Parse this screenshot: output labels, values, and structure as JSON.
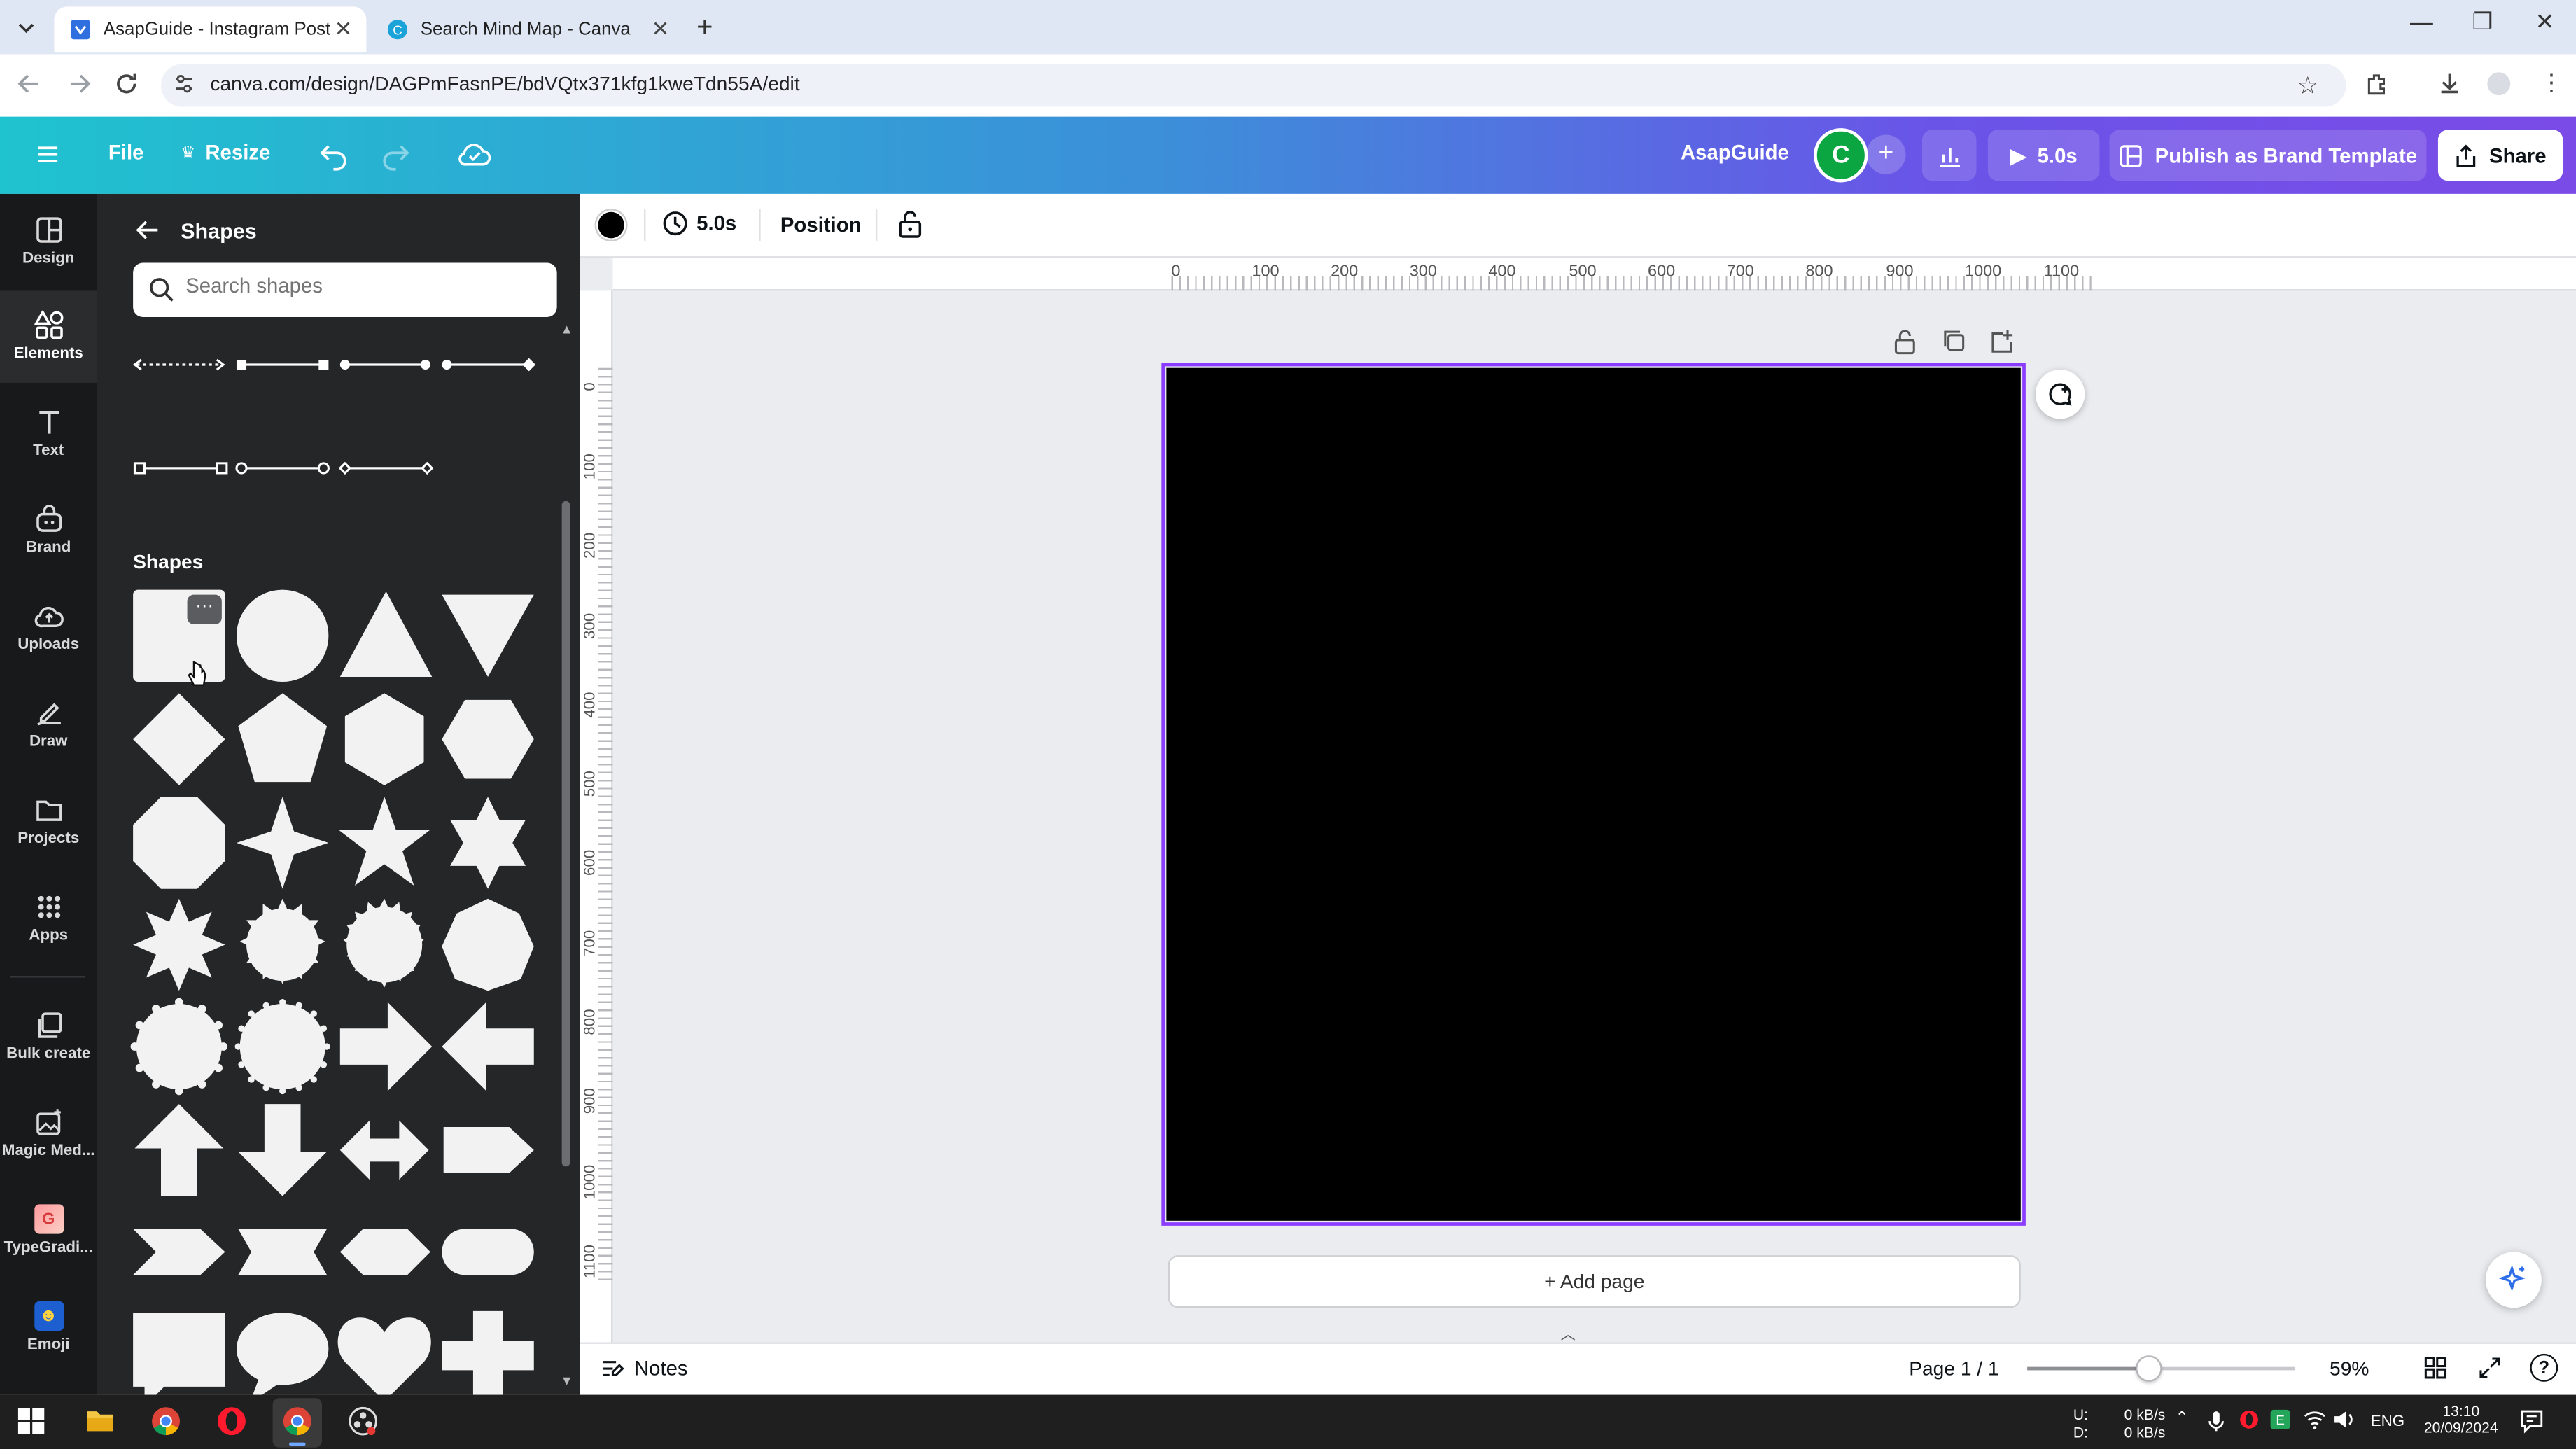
{
  "browser": {
    "tabs": [
      {
        "title": "AsapGuide - Instagram Post",
        "active": true
      },
      {
        "title": "Search Mind Map - Canva",
        "active": false
      }
    ],
    "url": "canva.com/design/DAGPmFasnPE/bdVQtx371kfg1kweTdn55A/edit"
  },
  "header": {
    "file_label": "File",
    "resize_label": "Resize",
    "team_name": "AsapGuide",
    "avatar_initial": "C",
    "play_duration": "5.0s",
    "publish_label": "Publish as Brand Template",
    "share_label": "Share"
  },
  "rail": {
    "items": [
      {
        "label": "Design",
        "icon": "design-icon"
      },
      {
        "label": "Elements",
        "icon": "elements-icon",
        "active": true
      },
      {
        "label": "Text",
        "icon": "text-icon"
      },
      {
        "label": "Brand",
        "icon": "brand-icon"
      },
      {
        "label": "Uploads",
        "icon": "uploads-icon"
      },
      {
        "label": "Draw",
        "icon": "draw-icon"
      },
      {
        "label": "Projects",
        "icon": "projects-icon"
      },
      {
        "label": "Apps",
        "icon": "apps-icon"
      },
      {
        "label": "Bulk create",
        "icon": "bulk-create-icon"
      },
      {
        "label": "Magic Med...",
        "icon": "magic-media-icon"
      },
      {
        "label": "TypeGradi...",
        "icon": "typegradient-icon"
      },
      {
        "label": "Emoji",
        "icon": "emoji-icon"
      }
    ]
  },
  "panel": {
    "title": "Shapes",
    "search_placeholder": "Search shapes",
    "section_title": "Shapes"
  },
  "toolbar": {
    "duration": "5.0s",
    "position_label": "Position",
    "color": "#000000"
  },
  "ruler": {
    "top_labels": [
      "0",
      "100",
      "200",
      "300",
      "400",
      "500",
      "600",
      "700",
      "800",
      "900",
      "1000",
      "1100"
    ],
    "left_labels": [
      "0",
      "100",
      "200",
      "300",
      "400",
      "500",
      "600",
      "700",
      "800",
      "900",
      "1000",
      "1100"
    ]
  },
  "canvas": {
    "background": "#000000",
    "add_page_label": "+ Add page"
  },
  "bottom": {
    "notes_label": "Notes",
    "page_indicator": "Page 1 / 1",
    "zoom": "59%",
    "zoom_fraction": 0.45
  },
  "taskbar": {
    "net_up_label": "U:",
    "net_down_label": "D:",
    "net_up": "0 kB/s",
    "net_down": "0 kB/s",
    "lang": "ENG",
    "time": "13:10",
    "date": "20/09/2024"
  },
  "colors": {
    "accent": "#8b3dff",
    "header_start": "#1fc3cf",
    "header_end": "#7b4be7",
    "panel_bg": "#252627",
    "rail_bg": "#18191b"
  }
}
